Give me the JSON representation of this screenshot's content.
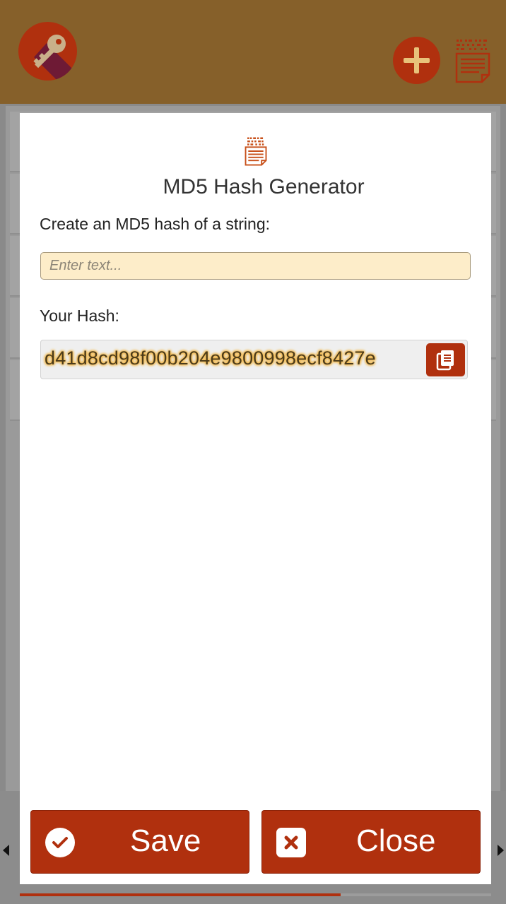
{
  "appbar": {
    "logo_icon": "key-icon",
    "add_icon": "plus-icon",
    "tool_icon": "hash-document-icon"
  },
  "modal": {
    "icon": "hash-document-icon",
    "title": "MD5 Hash Generator",
    "prompt_label": "Create an MD5 hash of a string:",
    "input_value": "",
    "input_placeholder": "Enter text...",
    "hash_label": "Your Hash:",
    "hash_value": "d41d8cd98f00b204e9800998ecf8427e",
    "copy_icon": "copy-icon",
    "save_label": "Save",
    "save_icon": "check-circle-icon",
    "close_label": "Close",
    "close_icon": "close-square-icon"
  },
  "progress": 0.68,
  "colors": {
    "appbar": "#86602a",
    "accent": "#b0300e",
    "input_bg": "#fdedc9",
    "hash_glow": "#f2b84a"
  }
}
